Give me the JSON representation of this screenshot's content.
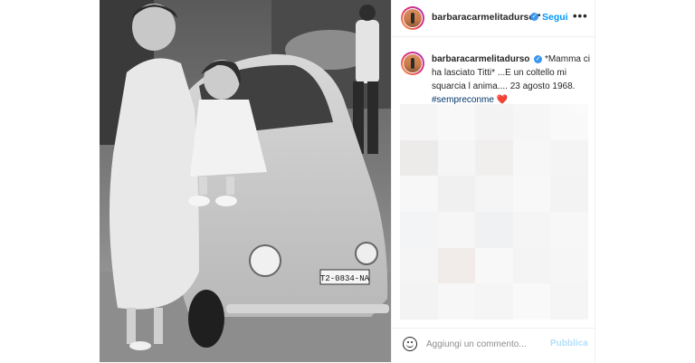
{
  "post": {
    "username": "barbaracarmelitadurso",
    "follow_label": "Segui",
    "separator": "•",
    "more_label": "•••",
    "caption_text": " *Mamma ci ha lasciato Titti* ...E un coltello mi squarcia l anima.... 23 agosto 1968. ",
    "hashtag": "#sempreconme",
    "heart": "❤️",
    "verified_mark": "✓",
    "photo": {
      "license_plate": "T2-0834-NA",
      "description_icon": "vintage-photo"
    }
  },
  "comment_box": {
    "placeholder": "Aggiungi un commento...",
    "publish_label": "Pubblica"
  },
  "colors": {
    "accent": "#0095f6",
    "hashtag": "#00376b",
    "heart": "#ed4956",
    "publish_disabled": "#b2dffc"
  },
  "blur_tiles": [
    "#f4f4f4",
    "#f8f8f8",
    "#f2f2f2",
    "#f6f6f6",
    "#f9f9f9",
    "#ece8e8",
    "#f5f5f5",
    "#f0eded",
    "#f7f7f7",
    "#f3f3f3",
    "#f7f7f7",
    "#efefef",
    "#f5f5f5",
    "#f8f8f8",
    "#f2f2f2",
    "#f1f3f5",
    "#f6f6f6",
    "#eef0f2",
    "#f4f4f4",
    "#f7f7f7",
    "#f5f5f5",
    "#f0ebe8",
    "#f8f8f8",
    "#f3f3f3",
    "#f6f6f6",
    "#f2f2f2",
    "#f7f7f7",
    "#f4f4f4",
    "#f9f9f9",
    "#f5f5f5"
  ]
}
